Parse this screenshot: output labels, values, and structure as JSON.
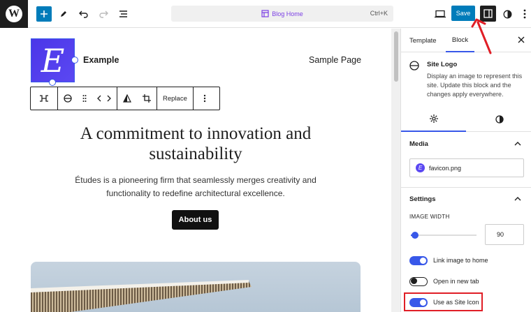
{
  "topbar": {
    "document_title": "Blog Home",
    "shortcut": "Ctrl+K",
    "save_label": "Save"
  },
  "canvas": {
    "logo_letter": "E",
    "site_title": "Example",
    "nav_link": "Sample Page",
    "toolbar_replace_label": "Replace",
    "headline": "A commitment to innovation and sustainability",
    "description": "Études is a pioneering firm that seamlessly merges creativity and functionality to redefine architectural excellence.",
    "cta_label": "About us"
  },
  "sidebar": {
    "tabs": [
      "Template",
      "Block"
    ],
    "active_tab": "Block",
    "block_name": "Site Logo",
    "block_description": "Display an image to represent this site. Update this block and the changes apply everywhere.",
    "media_heading": "Media",
    "media_file": "favicon.png",
    "settings_heading": "Settings",
    "image_width_label": "IMAGE WIDTH",
    "image_width_value": "90",
    "image_width_slider_fraction": 0.05,
    "toggles": [
      {
        "label": "Link image to home",
        "on": true
      },
      {
        "label": "Open in new tab",
        "on": false
      },
      {
        "label": "Use as Site Icon",
        "on": true
      }
    ]
  },
  "colors": {
    "accent": "#3858e9",
    "save_button": "#007cba",
    "logo_bg": "#5040ee",
    "highlight": "#e01e26",
    "arrow": "#e01e26"
  }
}
